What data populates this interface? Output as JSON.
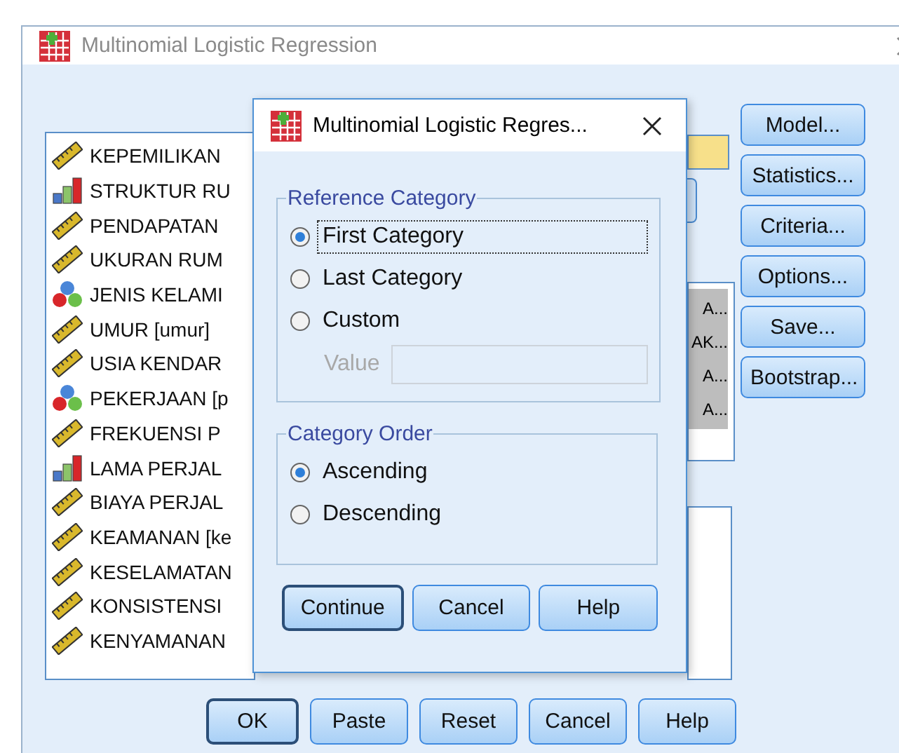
{
  "window": {
    "title": "Multinomial Logistic Regression"
  },
  "variables": [
    {
      "name": "KEPEMILIKAN",
      "kind": "scale"
    },
    {
      "name": "STRUKTUR RU",
      "kind": "ordinal"
    },
    {
      "name": "PENDAPATAN",
      "kind": "scale"
    },
    {
      "name": "UKURAN RUM",
      "kind": "scale"
    },
    {
      "name": "JENIS KELAMI",
      "kind": "nominal"
    },
    {
      "name": "UMUR [umur]",
      "kind": "scale"
    },
    {
      "name": "USIA KENDAR",
      "kind": "scale"
    },
    {
      "name": "PEKERJAAN [p",
      "kind": "nominal"
    },
    {
      "name": "FREKUENSI P",
      "kind": "scale"
    },
    {
      "name": "LAMA PERJAL",
      "kind": "ordinal"
    },
    {
      "name": "BIAYA PERJAL",
      "kind": "scale"
    },
    {
      "name": "KEAMANAN [ke",
      "kind": "scale"
    },
    {
      "name": "KESELAMATAN",
      "kind": "scale"
    },
    {
      "name": "KONSISTENSI",
      "kind": "scale"
    },
    {
      "name": "KENYAMANAN",
      "kind": "scale"
    }
  ],
  "factors": [
    "A...",
    "AK...",
    "A...",
    "A..."
  ],
  "side_buttons": [
    "Model...",
    "Statistics...",
    "Criteria...",
    "Options...",
    "Save...",
    "Bootstrap..."
  ],
  "bottom_buttons": [
    {
      "label": "OK",
      "default": true
    },
    {
      "label": "Paste",
      "default": false
    },
    {
      "label": "Reset",
      "default": false
    },
    {
      "label": "Cancel",
      "default": false
    },
    {
      "label": "Help",
      "default": false
    }
  ],
  "dialog": {
    "title": "Multinomial Logistic Regres...",
    "reference_category": {
      "title": "Reference Category",
      "options": [
        {
          "label": "First Category",
          "selected": true
        },
        {
          "label": "Last Category",
          "selected": false
        },
        {
          "label": "Custom",
          "selected": false
        }
      ],
      "value_label": "Value",
      "value_disabled": true
    },
    "category_order": {
      "title": "Category Order",
      "options": [
        {
          "label": "Ascending",
          "selected": true
        },
        {
          "label": "Descending",
          "selected": false
        }
      ]
    },
    "buttons": [
      {
        "label": "Continue",
        "default": true
      },
      {
        "label": "Cancel",
        "default": false
      },
      {
        "label": "Help",
        "default": false
      }
    ]
  }
}
